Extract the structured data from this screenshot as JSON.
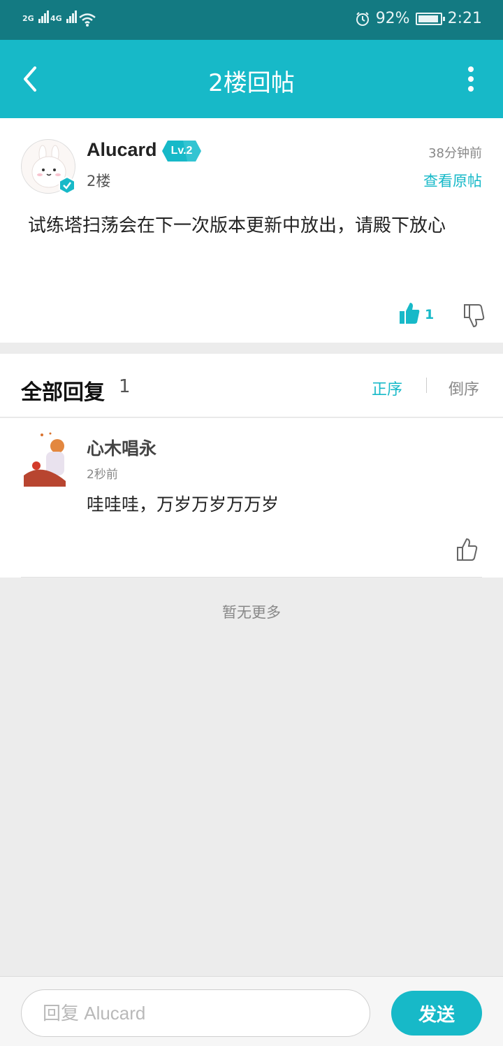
{
  "status_bar": {
    "signal_1": "2G",
    "signal_2": "4G",
    "battery": "92%",
    "time": "2:21",
    "icons": [
      "signal-icon",
      "wifi-icon",
      "alarm-icon",
      "battery-charging-icon"
    ]
  },
  "header": {
    "title": "2楼回帖",
    "back_icon": "chevron-left-icon",
    "more_icon": "more-vertical-icon",
    "color": "#17b9c8"
  },
  "post": {
    "author": "Alucard",
    "level": "Lv.2",
    "floor": "2楼",
    "time": "38分钟前",
    "view_original": "查看原帖",
    "content": "试练塔扫荡会在下一次版本更新中放出，请殿下放心",
    "like_count": "1",
    "verified": true
  },
  "replies": {
    "title": "全部回复",
    "count": "1",
    "sort_asc": "正序",
    "sort_desc": "倒序",
    "active_sort": "正序",
    "items": [
      {
        "author": "心木唱永",
        "time": "2秒前",
        "content": "哇哇哇，万岁万岁万万岁"
      }
    ],
    "no_more": "暂无更多"
  },
  "composer": {
    "placeholder": "回复 Alucard",
    "send_label": "发送"
  },
  "colors": {
    "accent": "#17b9c8",
    "status_bar": "#137a82",
    "background": "#ececec"
  }
}
